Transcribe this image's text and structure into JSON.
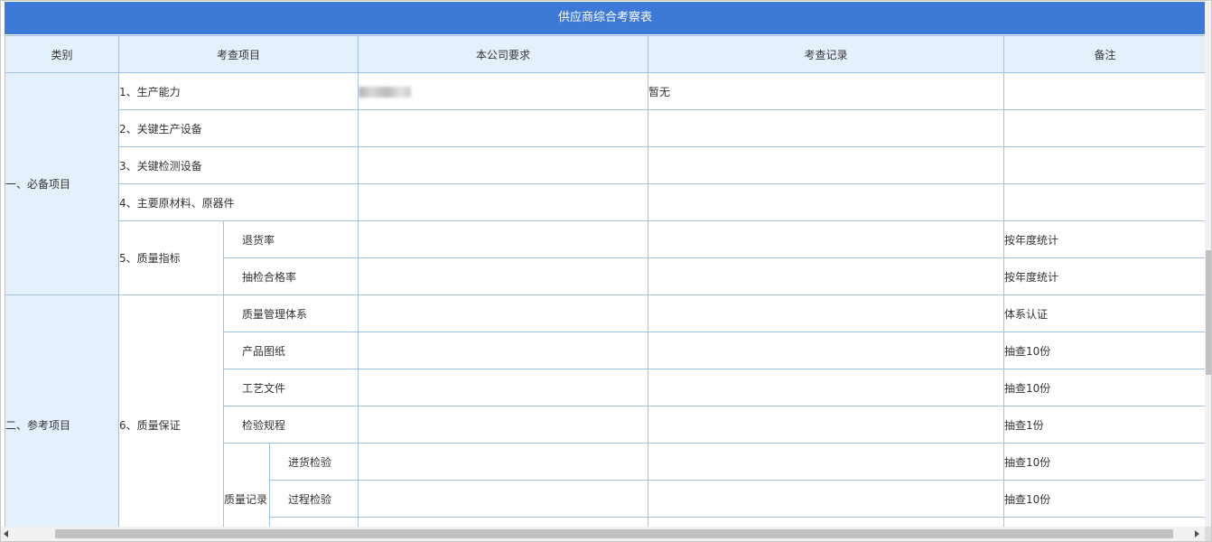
{
  "title": "供应商综合考察表",
  "headers": {
    "category": "类别",
    "item": "考查项目",
    "requirement": "本公司要求",
    "record": "考查记录",
    "note": "备注"
  },
  "rows": {
    "cat1": "一、必备项目",
    "cat2": "二、参考项目",
    "r1": {
      "item": "1、生产能力",
      "requirement_redacted": "blurred",
      "record": "暂无"
    },
    "r2": {
      "item": "2、关键生产设备"
    },
    "r3": {
      "item": "3、关键检测设备"
    },
    "r4": {
      "item": "4、主要原材料、原器件"
    },
    "r5": {
      "item": "5、质量指标",
      "sub1": {
        "label": "退货率",
        "note": "按年度统计"
      },
      "sub2": {
        "label": "抽检合格率",
        "note": "按年度统计"
      }
    },
    "r6": {
      "item": "6、质量保证",
      "sub1": {
        "label": "质量管理体系",
        "note": "体系认证"
      },
      "sub2": {
        "label": "产品图纸",
        "note": "抽查10份"
      },
      "sub3": {
        "label": "工艺文件",
        "note": "抽查10份"
      },
      "sub4": {
        "label": "检验规程",
        "note": "抽查1份"
      },
      "records_label": "质量记录",
      "rec1": {
        "label": "进货检验",
        "note": "抽查10份"
      },
      "rec2": {
        "label": "过程检验",
        "note": "抽查10份"
      }
    }
  },
  "colors": {
    "title_bg": "#3d7ad8",
    "header_bg": "#e4f1fc",
    "border": "#9dc3e6"
  }
}
